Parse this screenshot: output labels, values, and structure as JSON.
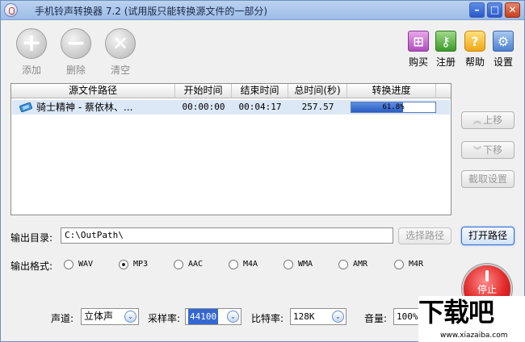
{
  "window": {
    "title": "手机铃声转换器 7.2 (试用版只能转换源文件的一部分)",
    "min_symbol": "–",
    "max_symbol": "□",
    "close_symbol": "✕"
  },
  "toolbar": {
    "add_label": "添加",
    "delete_label": "删除",
    "clear_label": "清空",
    "buy_label": "购买",
    "register_label": "注册",
    "help_label": "帮助",
    "settings_label": "设置"
  },
  "list": {
    "columns": [
      "源文件路径",
      "开始时间",
      "结束时间",
      "总时间(秒)",
      "转换进度"
    ],
    "rows": [
      {
        "path": "骑士精神 - 蔡依林、...",
        "start": "00:00:00",
        "end": "00:04:17",
        "total": "257.57",
        "progress_text": "61.8%",
        "progress": 0.618
      }
    ]
  },
  "side": {
    "up_label": "上移",
    "down_label": "下移",
    "cut_label": "截取设置"
  },
  "output": {
    "dir_label": "输出目录:",
    "dir_value": "C:\\OutPath\\",
    "choose_label": "选择路径",
    "open_label": "打开路径"
  },
  "format": {
    "label": "输出格式:",
    "options": [
      "WAV",
      "MP3",
      "AAC",
      "M4A",
      "WMA",
      "AMR",
      "M4R"
    ],
    "selected": "MP3"
  },
  "stop_label": "停止",
  "controls": {
    "channel_label": "声道:",
    "channel_value": "立体声",
    "samplerate_label": "采样率:",
    "samplerate_value": "44100",
    "bitrate_label": "比特率:",
    "bitrate_value": "128K",
    "volume_label": "音量:",
    "volume_value": "100%"
  },
  "watermark": {
    "text": "下载吧",
    "url": "www.xiazaiba.com"
  },
  "colors": {
    "progress_fill": "#2b5cc4",
    "selection": "#3468d0",
    "stop_red": "#e02525"
  }
}
